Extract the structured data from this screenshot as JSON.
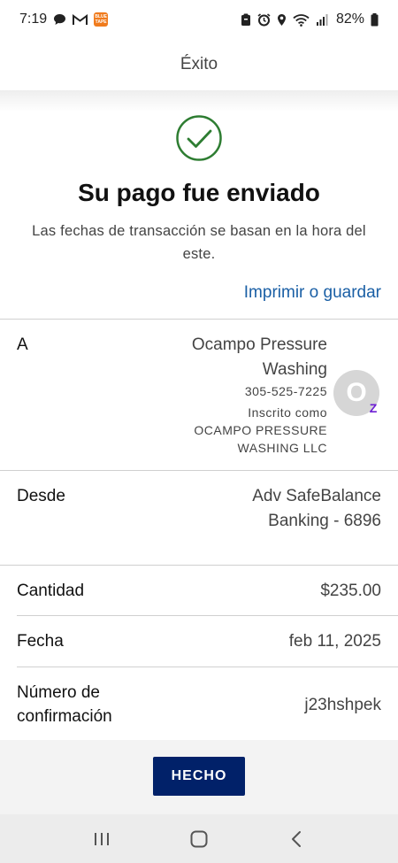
{
  "status_bar": {
    "time": "7:19",
    "app_badge_text": "BLUE TAPE",
    "battery": "82%"
  },
  "header": {
    "title": "Éxito"
  },
  "success": {
    "title": "Su pago fue enviado",
    "subtitle": "Las fechas de transacción se basan en la hora del este.",
    "print_link": "Imprimir o guardar",
    "accent_color": "#2e7d32"
  },
  "details": {
    "to": {
      "label": "A",
      "name_line1": "Ocampo Pressure",
      "name_line2": "Washing",
      "phone": "305-525-7225",
      "enrolled_as": "Inscrito como",
      "enrolled_name_line1": "OCAMPO PRESSURE",
      "enrolled_name_line2": "WASHING LLC",
      "avatar_initial": "O",
      "badge": "Z"
    },
    "from": {
      "label": "Desde",
      "value_line1": "Adv SafeBalance",
      "value_line2": "Banking - 6896"
    },
    "amount": {
      "label": "Cantidad",
      "value": "$235.00"
    },
    "date": {
      "label": "Fecha",
      "value": "feb 11, 2025"
    },
    "confirmation": {
      "label_line1": "Número de",
      "label_line2": "confirmación",
      "value": "j23hshpek"
    }
  },
  "actions": {
    "done_label": "HECHO",
    "done_color": "#012169"
  },
  "nav_bar": {
    "recent_icon": "recent-apps-icon",
    "home_icon": "home-icon",
    "back_icon": "back-icon"
  }
}
